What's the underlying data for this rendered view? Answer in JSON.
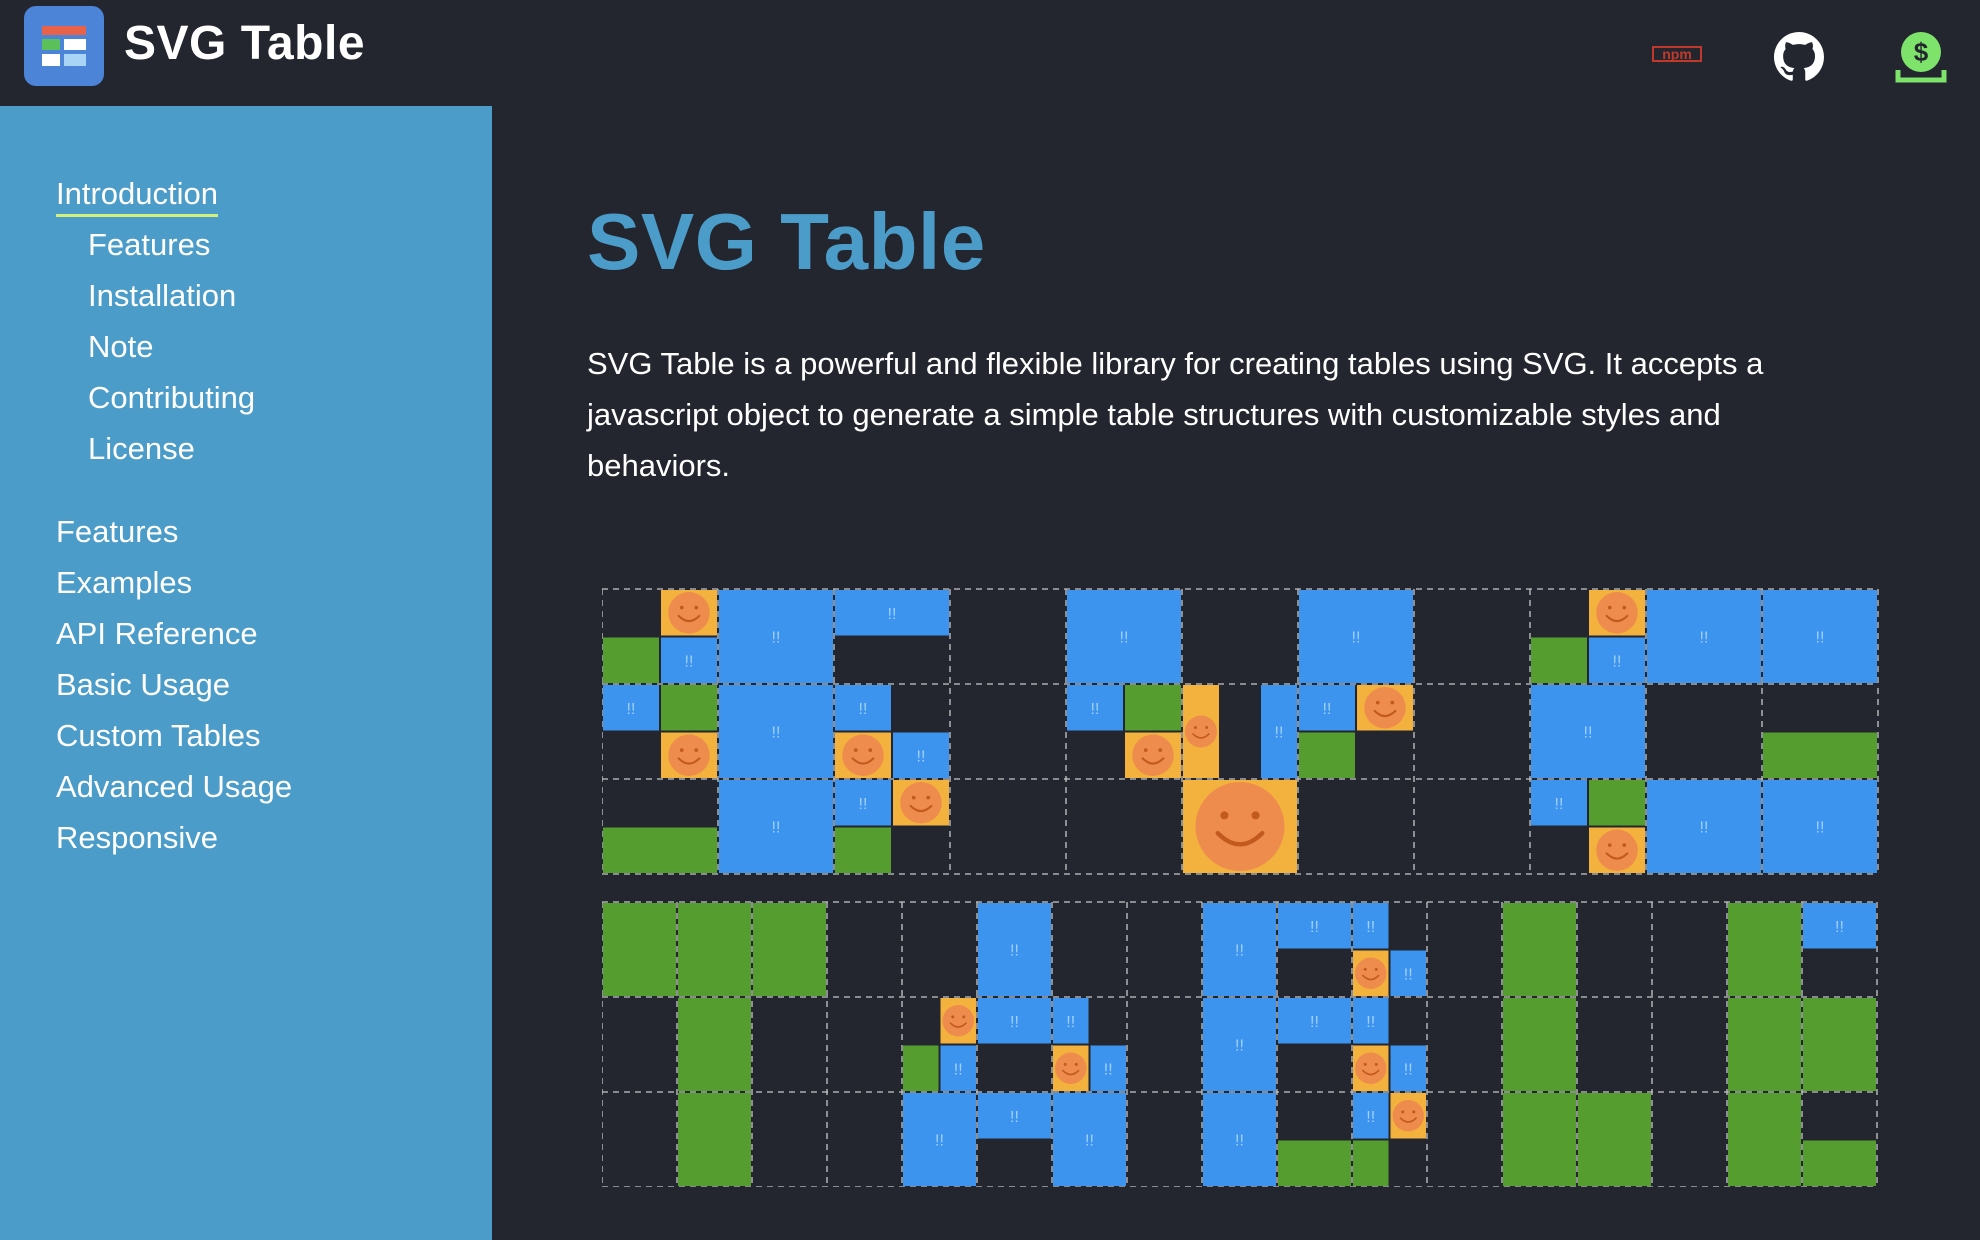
{
  "header": {
    "title": "SVG Table",
    "icons": [
      "logo-icon",
      "npm-icon",
      "github-icon",
      "sponsor-icon"
    ],
    "npm_label": "npm"
  },
  "sidebar": {
    "items": [
      {
        "label": "Introduction",
        "active": true
      },
      {
        "label": "Features"
      },
      {
        "label": "Installation"
      },
      {
        "label": "Note"
      },
      {
        "label": "Contributing"
      },
      {
        "label": "License"
      },
      {
        "label": "Features"
      },
      {
        "label": "Examples"
      },
      {
        "label": "API Reference"
      },
      {
        "label": "Basic Usage"
      },
      {
        "label": "Custom Tables"
      },
      {
        "label": "Advanced Usage"
      },
      {
        "label": "Responsive"
      }
    ]
  },
  "main": {
    "title": "SVG Table",
    "intro": "SVG Table is a powerful and flexible library for creating tables using SVG. It accepts a javascript object to generate a simple table structures with customizable styles and behaviors."
  },
  "colors": {
    "page_bg": "#23262e",
    "sidebar_bg": "#4b9cc8",
    "title": "#4b9cc8",
    "active_underline": "#d2f07c",
    "cell_blue": "#3d94ef",
    "cell_green": "#559d2f",
    "cell_orange": "#f3b23e",
    "face": "#ee8c4d",
    "npm_red": "#c0392b",
    "sponsor_green": "#7ee36a"
  },
  "demo": {
    "blue_mark": "!!"
  }
}
